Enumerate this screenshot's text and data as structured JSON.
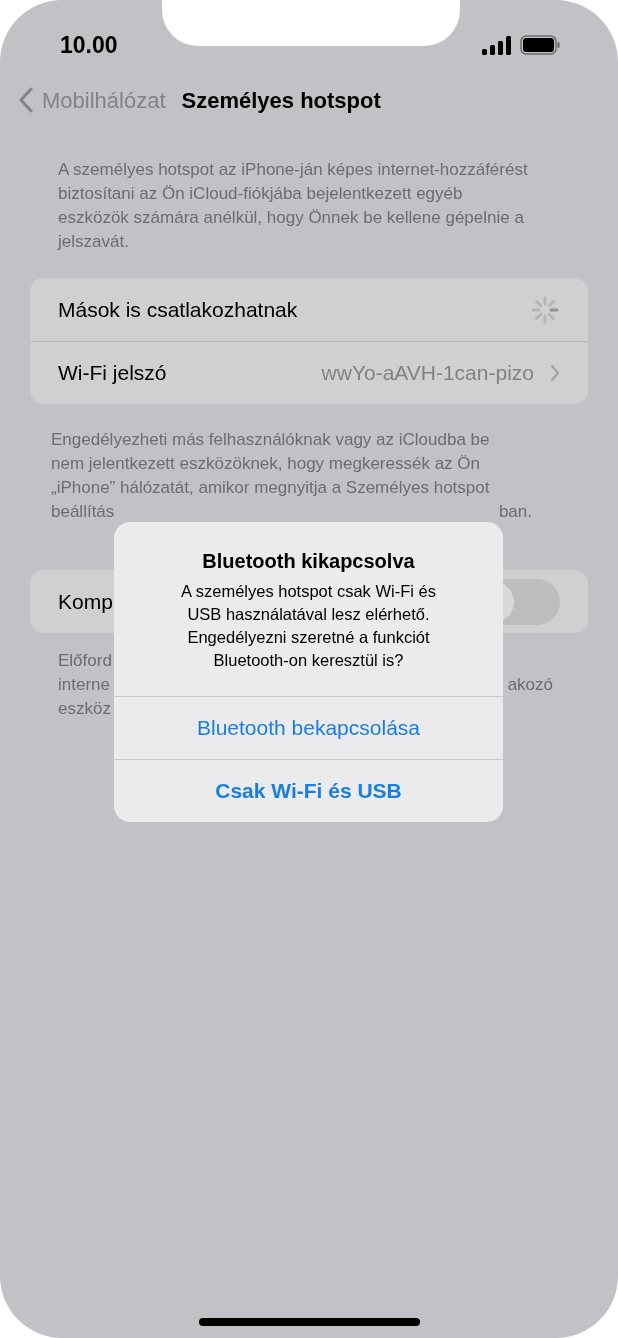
{
  "status_bar": {
    "time": "10.00"
  },
  "nav": {
    "back": "Mobilhálózat",
    "title": "Személyes hotspot"
  },
  "intro": "A személyes hotspot az iPhone-ján képes internet-hozzáférést biztosítani az Ön iCloud-fiókjába bejelentkezett egyéb eszközök számára anélkül, hogy Önnek be kellene gépelnie a jelszavát.",
  "settings": [
    {
      "kind": "spinner",
      "label": "Mások is csatlakozhatnak"
    },
    {
      "kind": "link",
      "label": "Wi-Fi jelszó",
      "value": "wwYo-aAVH-1can-pizo"
    }
  ],
  "footer_lines": [
    {
      "left": "Engedélyezheti más felhasználóknak vagy az iCloudba be"
    },
    {
      "left": "nem jelentkezett eszközöknek, hogy megkeressék az Ön"
    },
    {
      "left": "„iPhone” hálózatát, amikor megnyitja a Személyes hotspot"
    },
    {
      "left": "beállítás",
      "right": "ban."
    }
  ],
  "compat": {
    "label": "Komp",
    "on": false
  },
  "compat_footer_lines": [
    {
      "left": "Előford"
    },
    {
      "left": "interne",
      "right": "akozó"
    },
    {
      "left": "eszköz"
    }
  ],
  "alert": {
    "title": "Bluetooth kikapcsolva",
    "message": "A személyes hotspot csak Wi-Fi és USB használatával lesz elérhető. Engedélyezni szeretné a funkciót Bluetooth-on keresztül is?",
    "buttons": [
      {
        "label": "Bluetooth bekapcsolása",
        "bold": false
      },
      {
        "label": "Csak Wi-Fi és USB",
        "bold": true
      }
    ]
  }
}
